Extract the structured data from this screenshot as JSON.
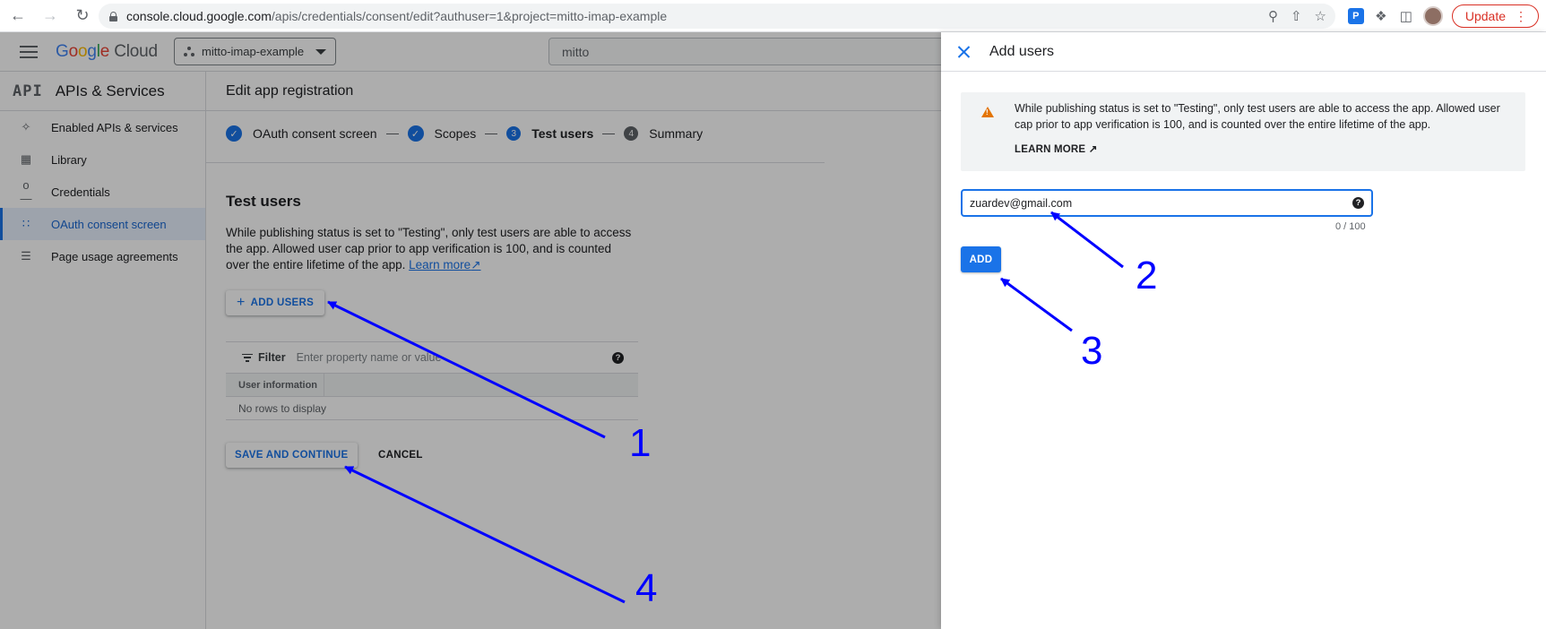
{
  "browser": {
    "url_host": "console.cloud.google.com",
    "url_path": "/apis/credentials/consent/edit?authuser=1&project=mitto-imap-example",
    "update_label": "Update"
  },
  "gcp_header": {
    "logo_google": "Google",
    "logo_cloud": "Cloud",
    "project": "mitto-imap-example",
    "search_value": "mitto"
  },
  "sidebar": {
    "logo": "API",
    "title": "APIs & Services",
    "items": [
      {
        "label": "Enabled APIs & services",
        "icon": "enabled-apis-icon"
      },
      {
        "label": "Library",
        "icon": "library-icon"
      },
      {
        "label": "Credentials",
        "icon": "key-icon"
      },
      {
        "label": "OAuth consent screen",
        "icon": "consent-icon",
        "active": true
      },
      {
        "label": "Page usage agreements",
        "icon": "settings-list-icon"
      }
    ]
  },
  "main": {
    "header": "Edit app registration",
    "steps": [
      {
        "label": "OAuth consent screen",
        "state": "done"
      },
      {
        "label": "Scopes",
        "state": "done"
      },
      {
        "number": "3",
        "label": "Test users",
        "state": "current"
      },
      {
        "number": "4",
        "label": "Summary",
        "state": "pending"
      }
    ],
    "section_title": "Test users",
    "description": "While publishing status is set to \"Testing\", only test users are able to access the app. Allowed user cap prior to app verification is 100, and is counted over the entire lifetime of the app.",
    "learn_more": "Learn more",
    "add_users_label": "ADD USERS",
    "filter_label": "Filter",
    "filter_placeholder": "Enter property name or value",
    "column_header": "User information",
    "empty_text": "No rows to display",
    "save_label": "SAVE AND CONTINUE",
    "cancel_label": "CANCEL"
  },
  "panel": {
    "title": "Add users",
    "notice": "While publishing status is set to \"Testing\", only test users are able to access the app. Allowed user cap prior to app verification is 100, and is counted over the entire lifetime of the app.",
    "learn_more": "LEARN MORE",
    "email_value": "zuardev@gmail.com",
    "counter": "0 / 100",
    "add_label": "ADD"
  },
  "annotations": {
    "color": "#0000ff",
    "labels": [
      "1",
      "2",
      "3",
      "4"
    ]
  }
}
